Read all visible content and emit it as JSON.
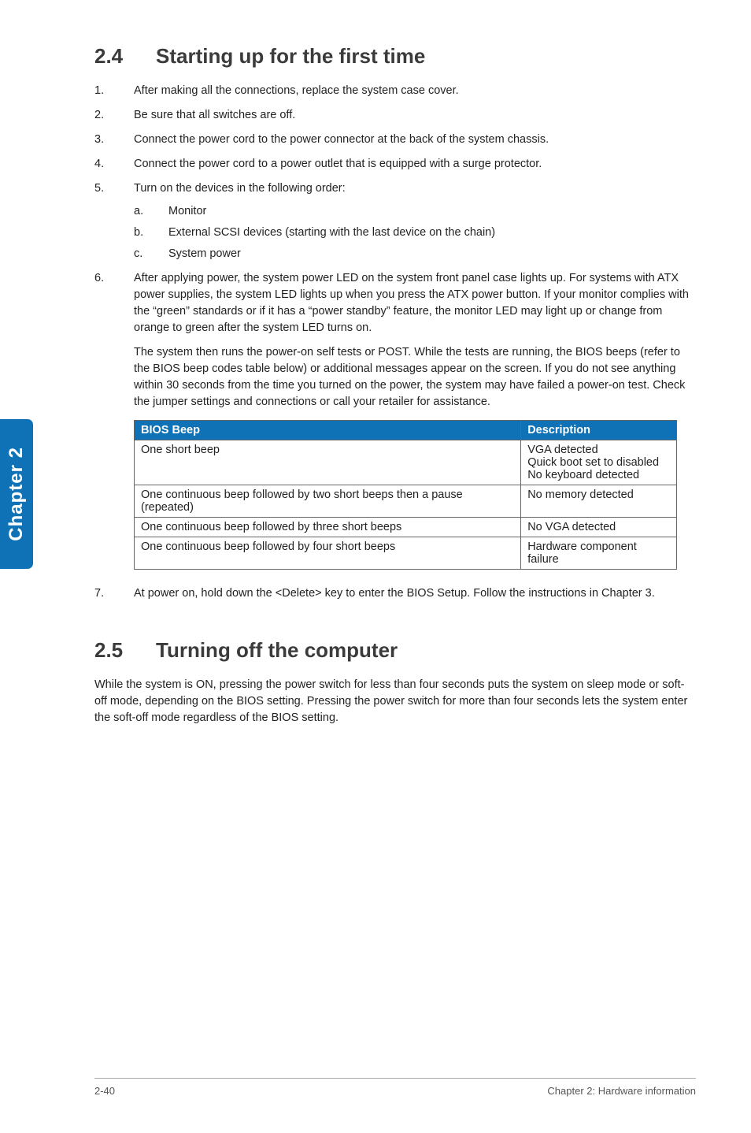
{
  "sidebar": {
    "tab_label": "Chapter 2"
  },
  "section_24": {
    "number": "2.4",
    "title": "Starting up for the first time",
    "steps": [
      {
        "n": "1.",
        "text": "After making all the connections, replace the system case cover."
      },
      {
        "n": "2.",
        "text": "Be sure that all switches are off."
      },
      {
        "n": "3.",
        "text": "Connect the power cord to the power connector at the back of the system chassis."
      },
      {
        "n": "4.",
        "text": "Connect the power cord to a power outlet that is equipped with a surge protector."
      },
      {
        "n": "5.",
        "text": "Turn on the devices in the following order:",
        "sub": [
          {
            "sn": "a.",
            "text": "Monitor"
          },
          {
            "sn": "b.",
            "text": "External SCSI devices (starting with the last device on the chain)"
          },
          {
            "sn": "c.",
            "text": "System power"
          }
        ]
      },
      {
        "n": "6.",
        "text": "After applying power, the system power LED on the system front panel case lights up. For systems with ATX power supplies, the system LED lights up when you press the ATX power button. If your monitor complies with the “green” standards or if it has a “power standby” feature, the monitor LED may light up or change from orange to green after the system LED turns on."
      }
    ],
    "post_paragraph": "The system then runs the power-on self tests or POST. While the tests are running, the BIOS beeps (refer to the BIOS beep codes table below) or additional messages appear on the screen. If you do not see anything within 30 seconds from the time you turned on the power, the system may have failed a power-on test. Check the jumper settings and connections or call your retailer for assistance.",
    "table": {
      "headers": [
        "BIOS Beep",
        "Description"
      ],
      "rows": [
        [
          "One short beep",
          "VGA detected\nQuick boot set to disabled\nNo keyboard detected"
        ],
        [
          "One continuous beep followed by two short beeps then a pause (repeated)",
          "No memory detected"
        ],
        [
          "One continuous beep followed by three short beeps",
          "No VGA detected"
        ],
        [
          "One continuous beep followed by four short beeps",
          "Hardware component failure"
        ]
      ]
    },
    "step7": {
      "n": "7.",
      "text": "At power on, hold down the <Delete> key to enter the BIOS Setup. Follow the instructions in Chapter 3."
    }
  },
  "section_25": {
    "number": "2.5",
    "title": "Turning off the computer",
    "paragraph": "While the system is ON, pressing the power switch for less than four seconds puts the system on sleep mode or soft-off mode, depending on the BIOS setting. Pressing the power switch for more than four seconds lets the system enter the soft-off mode regardless of the BIOS setting."
  },
  "footer": {
    "page": "2-40",
    "chapter": "Chapter 2: Hardware information"
  }
}
